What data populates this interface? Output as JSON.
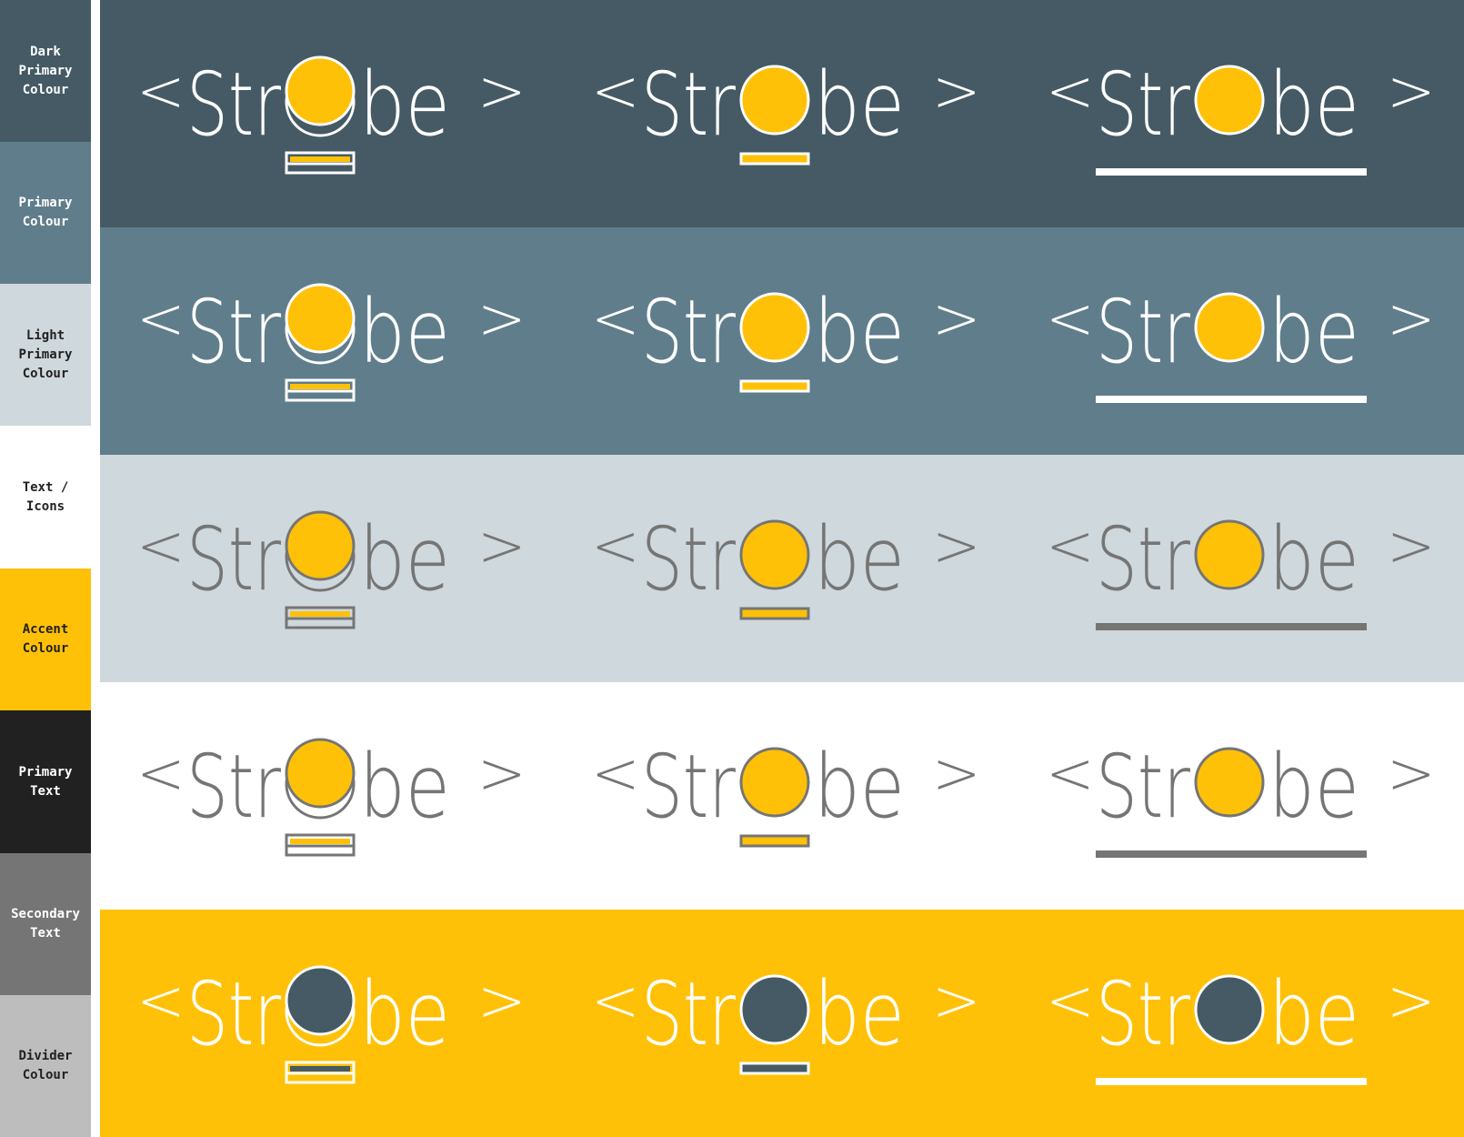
{
  "palette": [
    {
      "label_lines": [
        "Dark",
        "Primary",
        "Colour"
      ],
      "color": "#455A64",
      "text_color": "#FFFFFF"
    },
    {
      "label_lines": [
        "Primary",
        "Colour"
      ],
      "color": "#607D8B",
      "text_color": "#FFFFFF"
    },
    {
      "label_lines": [
        "Light",
        "Primary",
        "Colour"
      ],
      "color": "#CFD8DC",
      "text_color": "#212121"
    },
    {
      "label_lines": [
        "Text /",
        "Icons"
      ],
      "color": "#FFFFFF",
      "text_color": "#212121"
    },
    {
      "label_lines": [
        "Accent",
        "Colour"
      ],
      "color": "#FFC107",
      "text_color": "#212121"
    },
    {
      "label_lines": [
        "Primary",
        "Text"
      ],
      "color": "#212121",
      "text_color": "#FFFFFF"
    },
    {
      "label_lines": [
        "Secondary",
        "Text"
      ],
      "color": "#757575",
      "text_color": "#FFFFFF"
    },
    {
      "label_lines": [
        "Divider",
        "Colour"
      ],
      "color": "#BDBDBD",
      "text_color": "#212121"
    }
  ],
  "logo": {
    "left_bracket": "<",
    "prefix": "Str",
    "suffix": "be",
    "right_bracket": ">"
  },
  "logo_variants": [
    "stacked-circle-double-bar",
    "circle-small-bar",
    "circle-long-underline"
  ],
  "bands": [
    {
      "name": "dark-primary",
      "bg": "#455A64",
      "stroke": "#FFFFFF",
      "fill": "#FFC107"
    },
    {
      "name": "primary",
      "bg": "#607D8B",
      "stroke": "#FFFFFF",
      "fill": "#FFC107"
    },
    {
      "name": "light-primary",
      "bg": "#CFD8DC",
      "stroke": "#757575",
      "fill": "#FFC107"
    },
    {
      "name": "white",
      "bg": "#FFFFFF",
      "stroke": "#757575",
      "fill": "#FFC107"
    },
    {
      "name": "accent",
      "bg": "#FFC107",
      "stroke": "#FFFFFF",
      "fill": "#455A64"
    }
  ]
}
